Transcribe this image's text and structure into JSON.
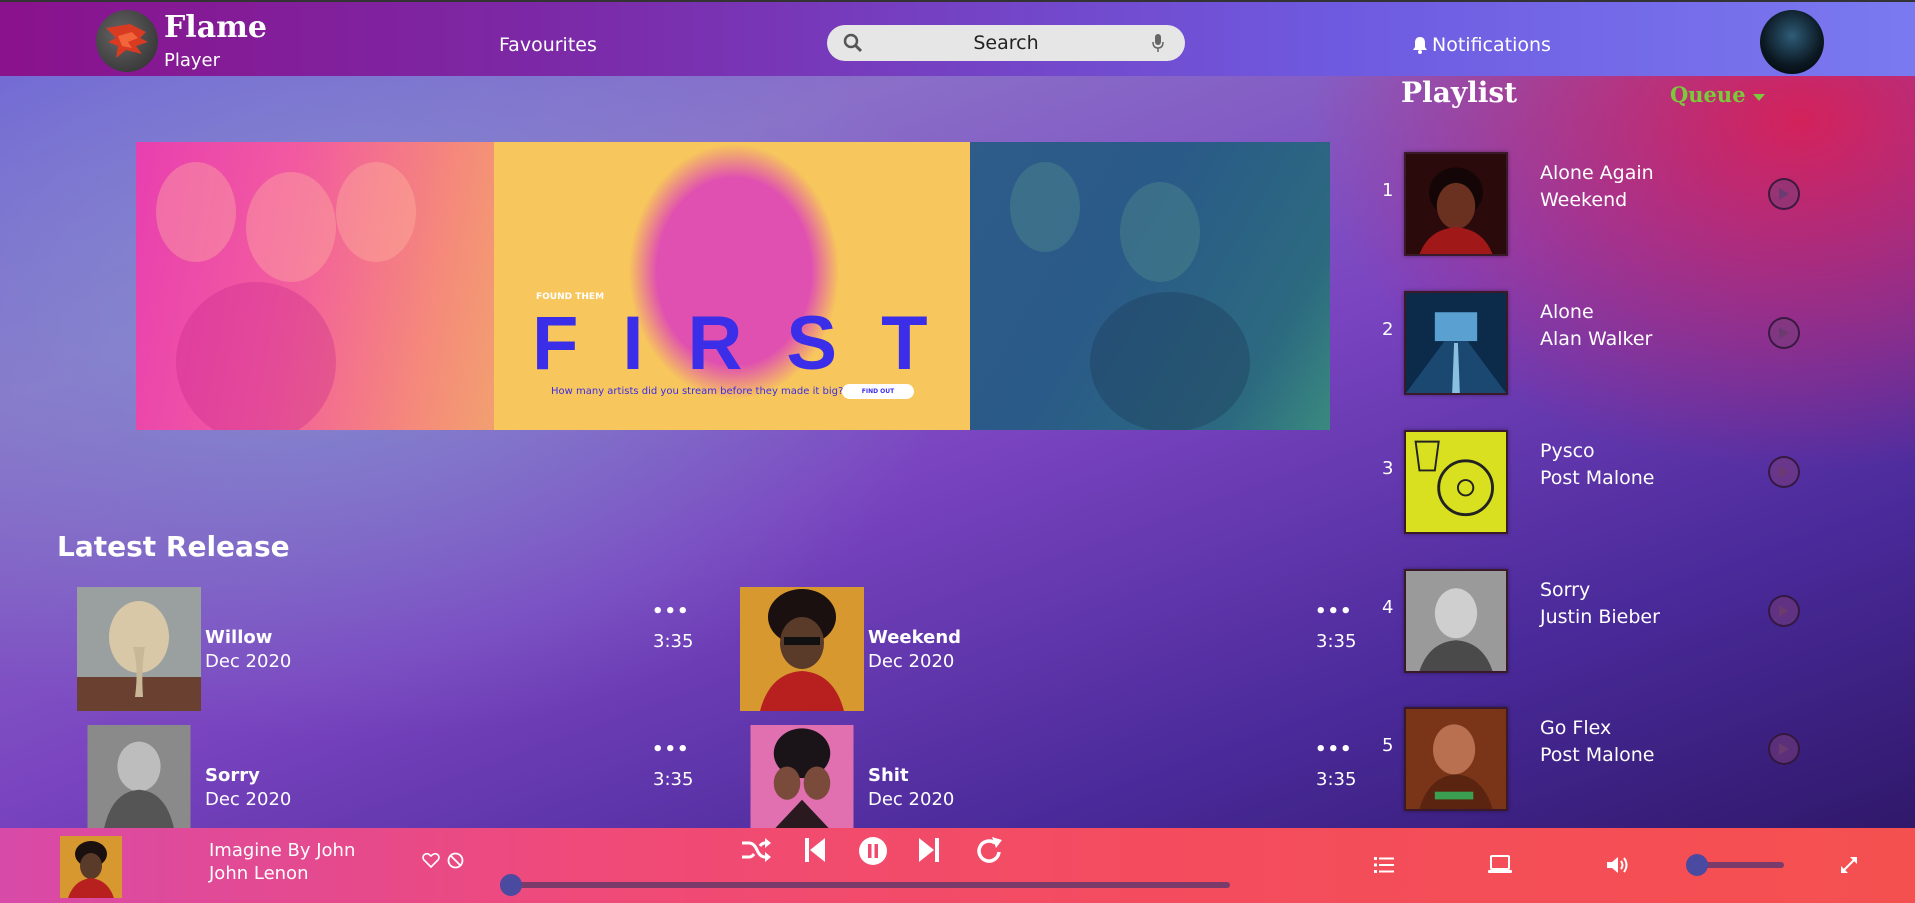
{
  "header": {
    "brand_title": "Flame",
    "brand_subtitle": "Player",
    "nav_favourites": "Favourites",
    "search_label": "Search",
    "notifications": "Notifications"
  },
  "banner": {
    "found_label": "FOUND THEM",
    "headline": "FIRST",
    "question": "How many artists did you stream before they made it big?",
    "cta": "FIND OUT"
  },
  "latest": {
    "title": "Latest Release",
    "items": [
      {
        "name": "Willow",
        "date": "Dec 2020",
        "more": "•••",
        "duration": "3:35",
        "art": "braid-portrait"
      },
      {
        "name": "Weekend",
        "date": "Dec 2020",
        "more": "•••",
        "duration": "3:35",
        "art": "weekend-portrait"
      },
      {
        "name": "Sorry",
        "date": "Dec 2020",
        "more": "•••",
        "duration": "3:35",
        "art": "grey-portrait"
      },
      {
        "name": "Shit",
        "date": "Dec 2020",
        "more": "•••",
        "duration": "3:35",
        "art": "pink-album"
      }
    ]
  },
  "playlist": {
    "title": "Playlist",
    "queue_label": "Queue",
    "items": [
      {
        "num": "1",
        "song": "Alone Again",
        "artist": "Weekend"
      },
      {
        "num": "2",
        "song": "Alone",
        "artist": "Alan Walker"
      },
      {
        "num": "3",
        "song": "Pysco",
        "artist": "Post Malone"
      },
      {
        "num": "4",
        "song": "Sorry",
        "artist": "Justin Bieber"
      },
      {
        "num": "5",
        "song": "Go Flex",
        "artist": "Post Malone"
      }
    ]
  },
  "player": {
    "song": "Imagine By John",
    "artist": "John Lenon",
    "progress": 0.0,
    "volume": 0.0
  },
  "colors": {
    "queue_accent": "#7acb3a",
    "player_bar": "#f44c5e",
    "topbar": "#7b2aa8"
  }
}
